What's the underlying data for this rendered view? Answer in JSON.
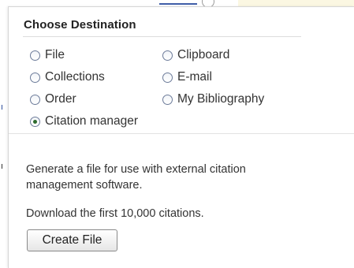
{
  "popup": {
    "title": "Choose Destination",
    "options": [
      {
        "label": "File",
        "selected": false
      },
      {
        "label": "Clipboard",
        "selected": false
      },
      {
        "label": "Collections",
        "selected": false
      },
      {
        "label": "E-mail",
        "selected": false
      },
      {
        "label": "Order",
        "selected": false
      },
      {
        "label": "My Bibliography",
        "selected": false
      },
      {
        "label": "Citation manager",
        "selected": true
      }
    ],
    "description": "Generate a file for use with external citation management software.",
    "download_note": "Download the first 10,000 citations.",
    "create_button_label": "Create File"
  },
  "colors": {
    "text": "#333333",
    "title": "#222222",
    "radio_border": "#6c7b99",
    "radio_dot": "#2d6b2d",
    "divider": "#dcdcdc"
  }
}
